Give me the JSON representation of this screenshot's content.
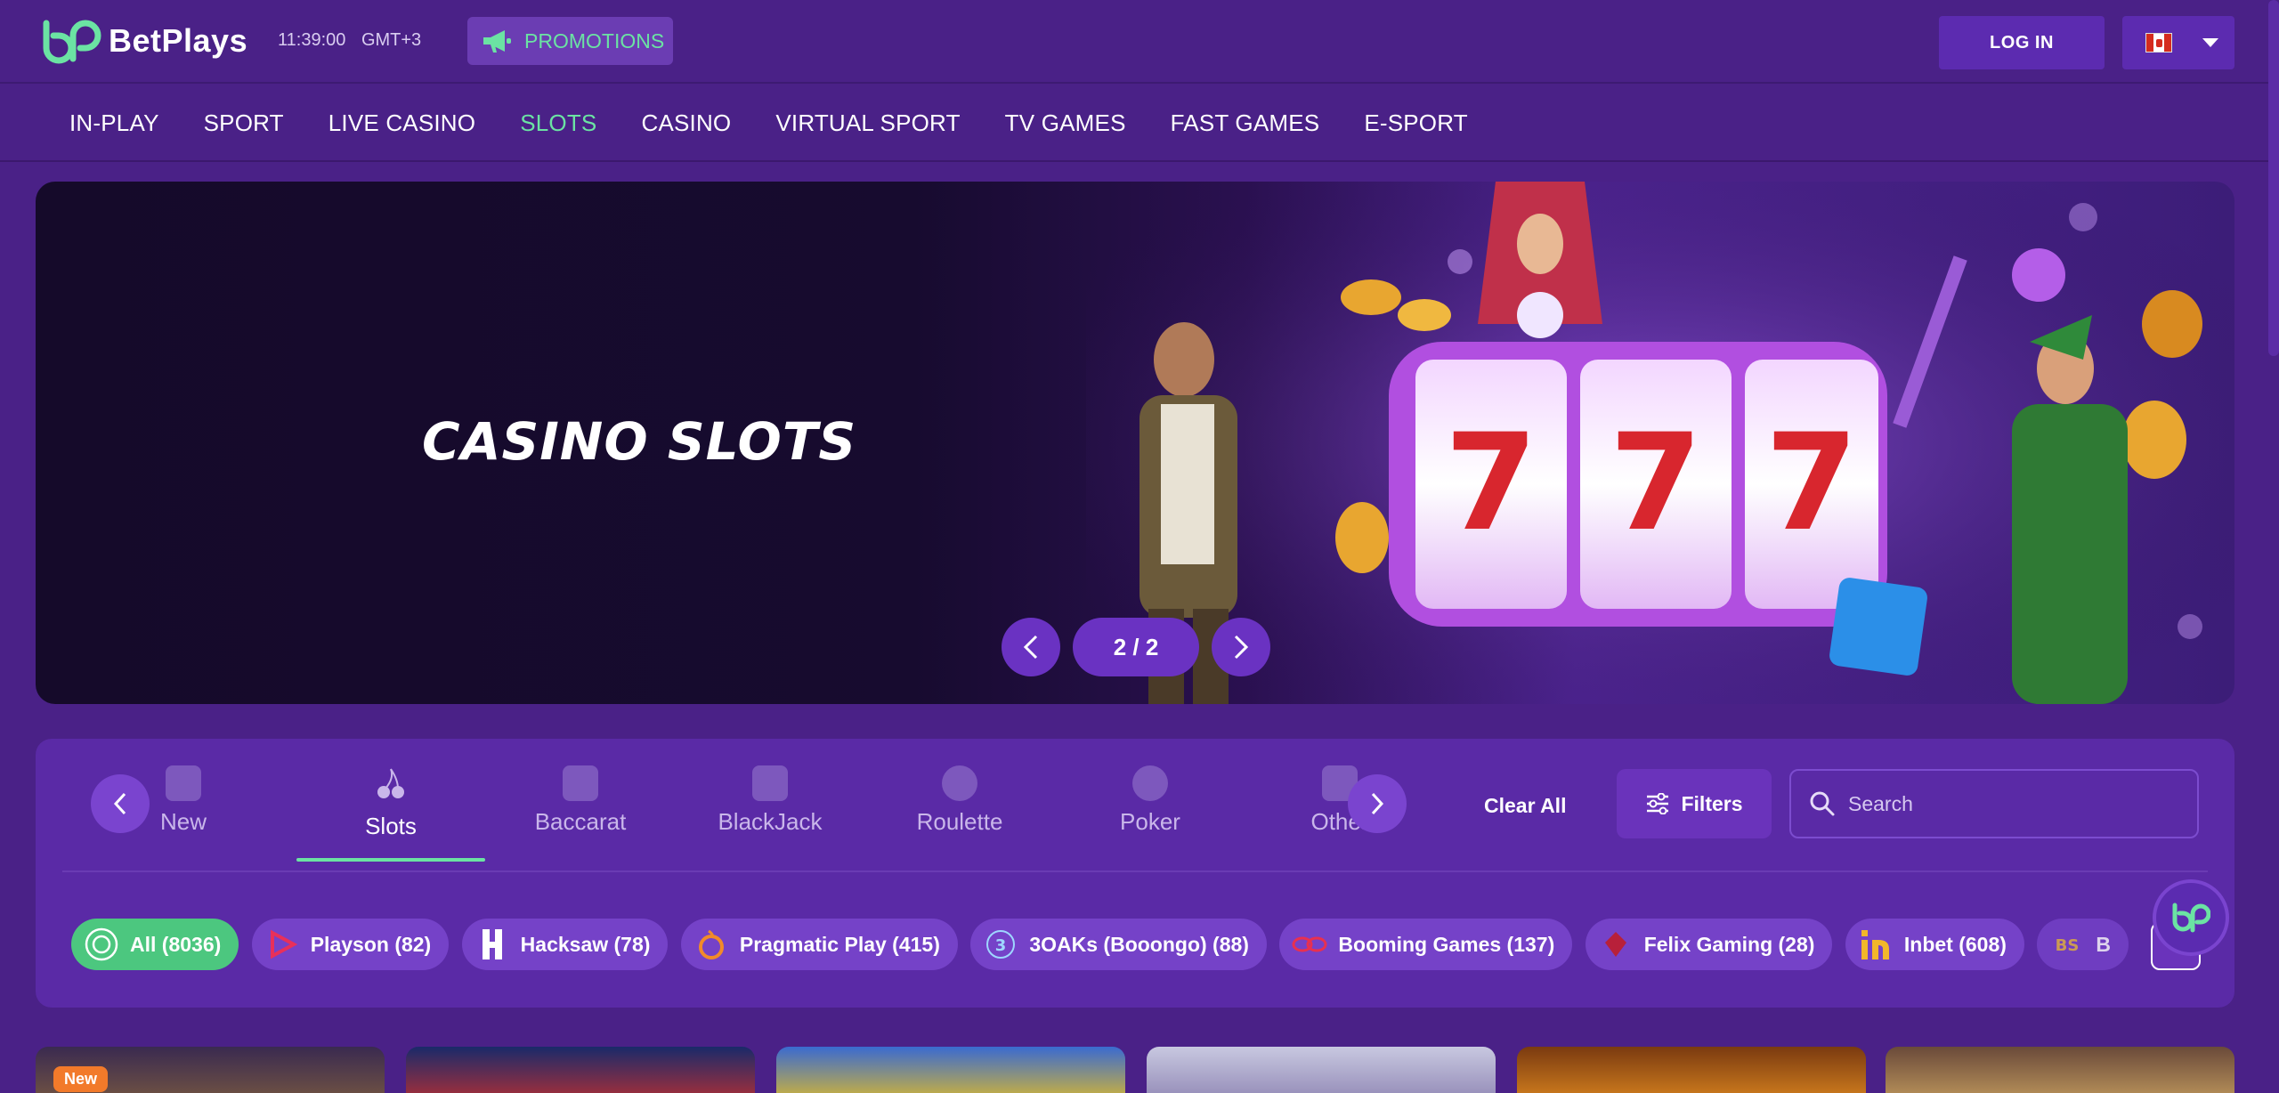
{
  "header": {
    "brand": "BetPlays",
    "time": "11:39:00",
    "timezone": "GMT+3",
    "promotions_label": "PROMOTIONS",
    "login_label": "LOG IN",
    "language_flag": "canada-flag-icon"
  },
  "nav": {
    "items": [
      "IN-PLAY",
      "SPORT",
      "LIVE CASINO",
      "SLOTS",
      "CASINO",
      "VIRTUAL SPORT",
      "TV GAMES",
      "FAST GAMES",
      "E-SPORT"
    ],
    "active": "SLOTS"
  },
  "hero": {
    "title": "CASINO SLOTS",
    "counter": "2 / 2"
  },
  "categories": {
    "items": [
      "New",
      "Slots",
      "Baccarat",
      "BlackJack",
      "Roulette",
      "Poker",
      "Other"
    ],
    "active": "Slots"
  },
  "filters": {
    "clear_all": "Clear All",
    "filters_label": "Filters",
    "search_placeholder": "Search"
  },
  "providers": [
    {
      "label": "All (8036)",
      "active": true
    },
    {
      "label": "Playson (82)"
    },
    {
      "label": "Hacksaw (78)"
    },
    {
      "label": "Pragmatic Play (415)"
    },
    {
      "label": "3OAKs (Booongo) (88)"
    },
    {
      "label": "Booming Games (137)"
    },
    {
      "label": "Felix Gaming (28)"
    },
    {
      "label": "Inbet (608)"
    },
    {
      "label": "B"
    }
  ],
  "games": {
    "first_badge": "New"
  },
  "colors": {
    "background": "#4a2187",
    "accent_green": "#6be3a3",
    "button_purple": "#5c2bb0",
    "active_provider": "#4cc77f"
  }
}
